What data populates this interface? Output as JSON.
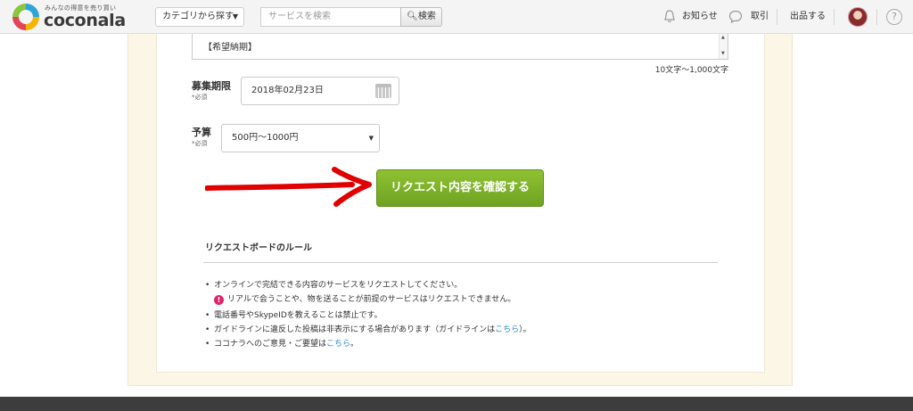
{
  "header": {
    "logo_tagline": "みんなの得意を売り買い",
    "logo_word": "coconala",
    "category_button": "カテゴリから探す",
    "search_placeholder": "サービスを検索",
    "search_button": "検索",
    "news": "お知らせ",
    "deal": "取引",
    "sell": "出品する",
    "help": "?"
  },
  "form": {
    "textarea_text": "【希望納期】",
    "char_count": "10文字〜1,000文字",
    "deadline_label": "募集期限",
    "deadline_required": "*必須",
    "deadline_value": "2018年02月23日",
    "budget_label": "予算",
    "budget_required": "*必須",
    "budget_value": "500円〜1000円",
    "confirm_button": "リクエスト内容を確認する"
  },
  "rules": {
    "title": "リクエストボードのルール",
    "item1": "オンラインで完結できる内容のサービスをリクエストしてください。",
    "item1_warning": "リアルで会うことや、物を送ることが前提のサービスはリクエストできません。",
    "item2": "電話番号やSkypeIDを教えることは禁止です。",
    "item3_pre": "ガイドラインに違反した投稿は非表示にする場合があります（ガイドラインは",
    "item3_link": "こちら",
    "item3_post": "）。",
    "item4_pre": "ココナラへのご意見・ご要望は",
    "item4_link": "こちら",
    "item4_post": "。"
  },
  "colors": {
    "brand_green": "#7cb32a",
    "link_blue": "#2a8ec4",
    "arrow_red": "#e00000",
    "warning_pink": "#e0246a"
  }
}
